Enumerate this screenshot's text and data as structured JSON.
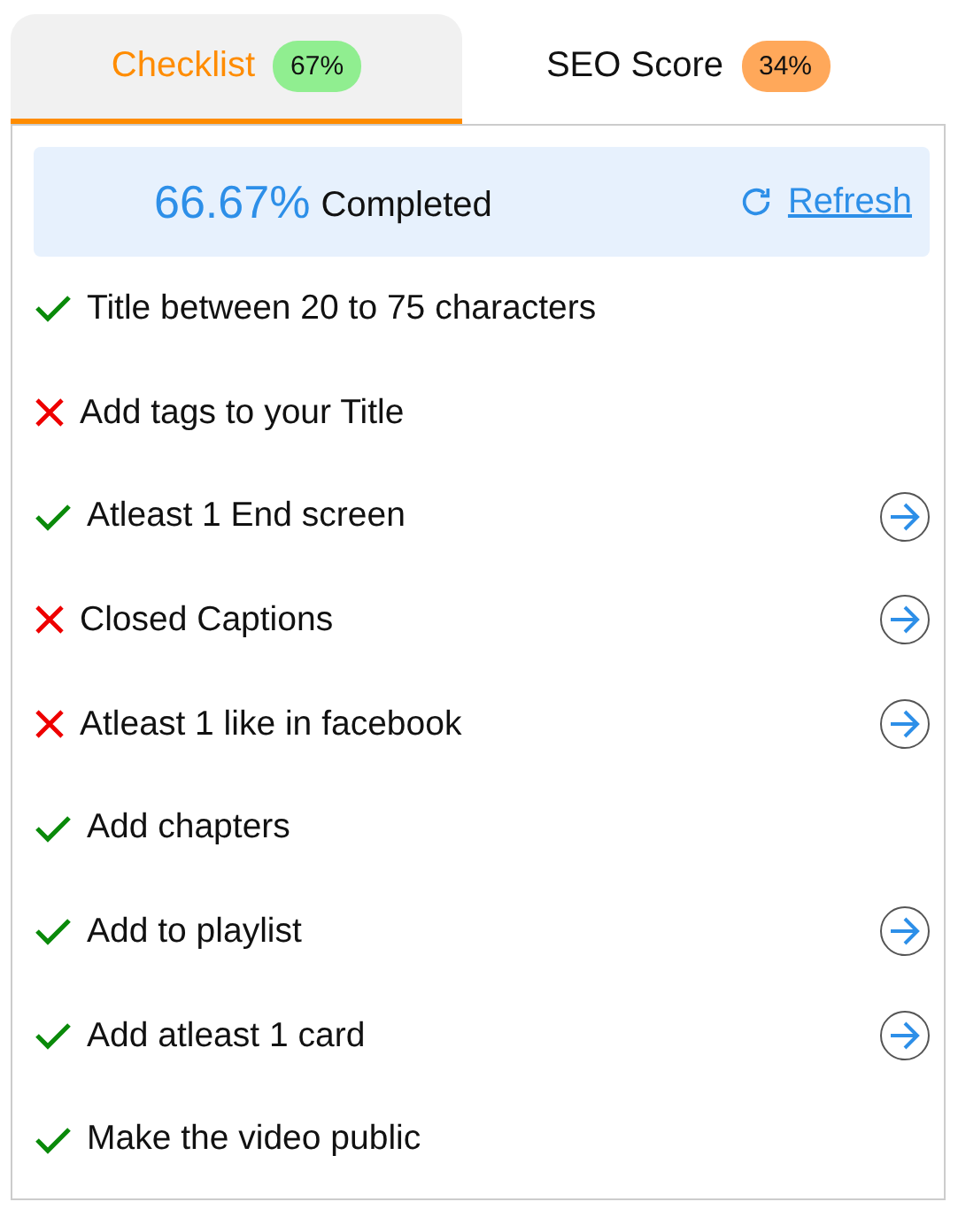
{
  "tabs": [
    {
      "label": "Checklist",
      "badge": "67%",
      "color": "#90ee90",
      "selected": true
    },
    {
      "label": "SEO Score",
      "badge": "34%",
      "color": "#ffa85a",
      "selected": false
    }
  ],
  "summary": {
    "percent": "66.67%",
    "label": "Completed",
    "action": "Refresh"
  },
  "items": [
    {
      "label": "Title between 20 to 75 characters",
      "done": true,
      "action": false
    },
    {
      "label": "Add tags to your Title",
      "done": false,
      "action": false
    },
    {
      "label": "Atleast 1 End screen",
      "done": true,
      "action": true
    },
    {
      "label": "Closed Captions",
      "done": false,
      "action": true
    },
    {
      "label": "Atleast 1 like in facebook",
      "done": false,
      "action": true
    },
    {
      "label": "Add chapters",
      "done": true,
      "action": false
    },
    {
      "label": "Add to playlist",
      "done": true,
      "action": true
    },
    {
      "label": "Add atleast 1 card",
      "done": true,
      "action": true
    },
    {
      "label": "Make the video public",
      "done": true,
      "action": false
    }
  ]
}
